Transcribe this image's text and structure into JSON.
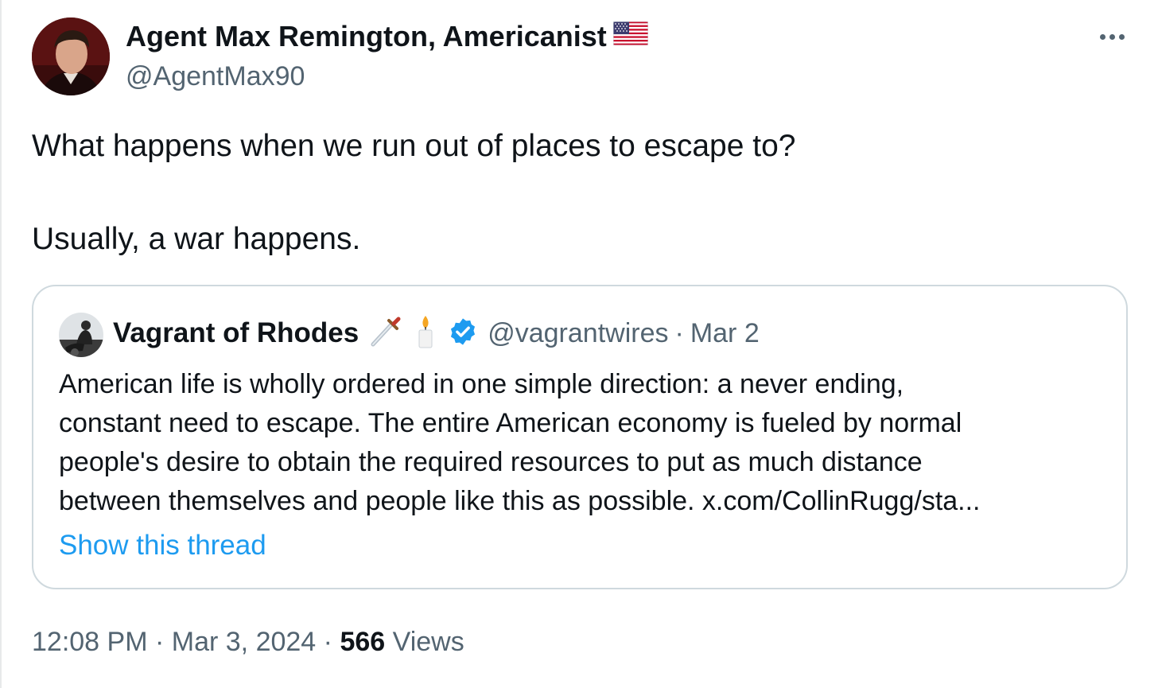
{
  "tweet": {
    "author_name": "Agent Max Remington, Americanist",
    "author_handle": "@AgentMax90",
    "lines": [
      "What happens when we run out of places to escape to?",
      "Usually, a war happens."
    ],
    "time": "12:08 PM",
    "date": "Mar 3, 2024",
    "views_count": "566",
    "views_label": "Views",
    "separator": "·"
  },
  "quoted": {
    "author_name": "Vagrant of Rhodes",
    "author_handle": "@vagrantwires",
    "separator": "·",
    "date": "Mar 2",
    "lines": [
      "American life is wholly ordered in one simple direction: a never ending,",
      "constant need to escape. The entire American economy is fueled by normal",
      "people's desire to obtain the required resources to put as much distance",
      "between themselves and people like this as possible. x.com/CollinRugg/sta..."
    ],
    "show_thread": "Show this thread",
    "emoji_icons": [
      "dagger-icon",
      "candle-icon"
    ],
    "verified_icon": "verified-badge-icon"
  },
  "colors": {
    "text": "#0f1419",
    "secondary": "#536471",
    "link": "#1d9bf0",
    "border": "#cfd9de"
  }
}
